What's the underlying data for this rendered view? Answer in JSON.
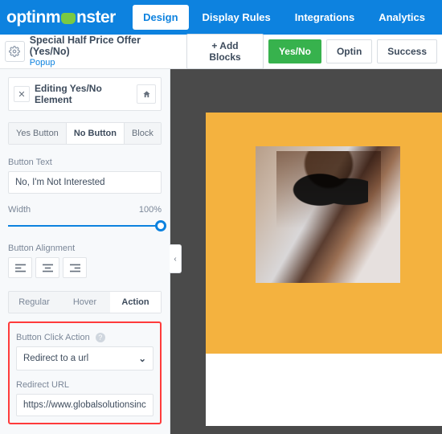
{
  "brand": {
    "name_a": "optin",
    "name_b": "m",
    "name_c": "nster"
  },
  "topnav": {
    "design": "Design",
    "display_rules": "Display Rules",
    "integrations": "Integrations",
    "analytics": "Analytics"
  },
  "campaign": {
    "title": "Special Half Price Offer (Yes/No)",
    "type": "Popup",
    "add_blocks": "+ Add Blocks",
    "views": {
      "yesno": "Yes/No",
      "optin": "Optin",
      "success": "Success"
    }
  },
  "editor": {
    "heading": "Editing Yes/No Element",
    "segs": {
      "yes": "Yes Button",
      "no": "No Button",
      "block": "Block"
    },
    "button_text_label": "Button Text",
    "button_text_value": "No, I'm Not Interested",
    "width_label": "Width",
    "width_value": "100%",
    "alignment_label": "Button Alignment",
    "state_tabs": {
      "regular": "Regular",
      "hover": "Hover",
      "action": "Action"
    },
    "click_action_label": "Button Click Action",
    "click_action_value": "Redirect to a url",
    "redirect_label": "Redirect URL",
    "redirect_value": "https://www.globalsolutionsinc.com/othe"
  },
  "icons": {
    "close": "✕",
    "chevron_left": "‹",
    "chevron_down": "⌄",
    "help": "?"
  }
}
